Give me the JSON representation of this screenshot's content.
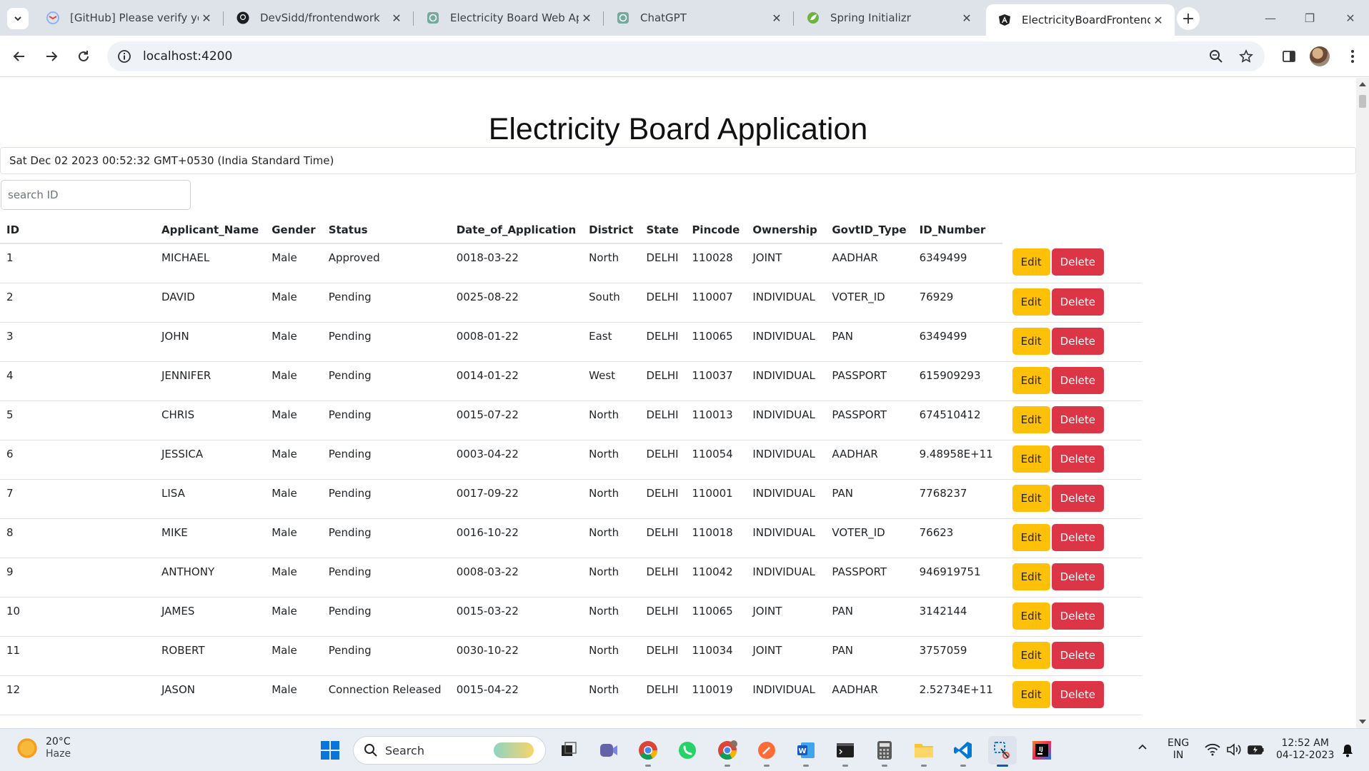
{
  "browser": {
    "tabs": [
      {
        "title": "[GitHub] Please verify your",
        "icon": "gmail-icon"
      },
      {
        "title": "DevSidd/frontendwork",
        "icon": "github-icon"
      },
      {
        "title": "Electricity Board Web App",
        "icon": "chatgpt-icon"
      },
      {
        "title": "ChatGPT",
        "icon": "chatgpt-icon"
      },
      {
        "title": "Spring Initializr",
        "icon": "spring-icon"
      },
      {
        "title": "ElectricityBoardFrontend",
        "icon": "angular-icon"
      }
    ],
    "url": "localhost:4200"
  },
  "page": {
    "title": "Electricity Board Application",
    "datetime": "Sat Dec 02 2023 00:52:32 GMT+0530 (India Standard Time)",
    "search_placeholder": "search ID",
    "edit_label": "Edit",
    "delete_label": "Delete"
  },
  "table": {
    "headers": [
      "ID",
      "Applicant_Name",
      "Gender",
      "Status",
      "Date_of_Application",
      "District",
      "State",
      "Pincode",
      "Ownership",
      "GovtID_Type",
      "ID_Number"
    ],
    "rows": [
      [
        "1",
        "MICHAEL",
        "Male",
        "Approved",
        "0018-03-22",
        "North",
        "DELHI",
        "110028",
        "JOINT",
        "AADHAR",
        "6349499"
      ],
      [
        "2",
        "DAVID",
        "Male",
        "Pending",
        "0025-08-22",
        "South",
        "DELHI",
        "110007",
        "INDIVIDUAL",
        "VOTER_ID",
        "76929"
      ],
      [
        "3",
        "JOHN",
        "Male",
        "Pending",
        "0008-01-22",
        "East",
        "DELHI",
        "110065",
        "INDIVIDUAL",
        "PAN",
        "6349499"
      ],
      [
        "4",
        "JENNIFER",
        "Male",
        "Pending",
        "0014-01-22",
        "West",
        "DELHI",
        "110037",
        "INDIVIDUAL",
        "PASSPORT",
        "615909293"
      ],
      [
        "5",
        "CHRIS",
        "Male",
        "Pending",
        "0015-07-22",
        "North",
        "DELHI",
        "110013",
        "INDIVIDUAL",
        "PASSPORT",
        "674510412"
      ],
      [
        "6",
        "JESSICA",
        "Male",
        "Pending",
        "0003-04-22",
        "North",
        "DELHI",
        "110054",
        "INDIVIDUAL",
        "AADHAR",
        "9.48958E+11"
      ],
      [
        "7",
        "LISA",
        "Male",
        "Pending",
        "0017-09-22",
        "North",
        "DELHI",
        "110001",
        "INDIVIDUAL",
        "PAN",
        "7768237"
      ],
      [
        "8",
        "MIKE",
        "Male",
        "Pending",
        "0016-10-22",
        "North",
        "DELHI",
        "110018",
        "INDIVIDUAL",
        "VOTER_ID",
        "76623"
      ],
      [
        "9",
        "ANTHONY",
        "Male",
        "Pending",
        "0008-03-22",
        "North",
        "DELHI",
        "110042",
        "INDIVIDUAL",
        "PASSPORT",
        "946919751"
      ],
      [
        "10",
        "JAMES",
        "Male",
        "Pending",
        "0015-03-22",
        "North",
        "DELHI",
        "110065",
        "JOINT",
        "PAN",
        "3142144"
      ],
      [
        "11",
        "ROBERT",
        "Male",
        "Pending",
        "0030-10-22",
        "North",
        "DELHI",
        "110034",
        "JOINT",
        "PAN",
        "3757059"
      ],
      [
        "12",
        "JASON",
        "Male",
        "Connection Released",
        "0015-04-22",
        "North",
        "DELHI",
        "110019",
        "INDIVIDUAL",
        "AADHAR",
        "2.52734E+11"
      ]
    ]
  },
  "taskbar": {
    "weather_temp": "20°C",
    "weather_desc": "Haze",
    "search_label": "Search",
    "lang_top": "ENG",
    "lang_bottom": "IN",
    "time": "12:52 AM",
    "date": "04-12-2023",
    "apps": [
      "teams-icon",
      "chrome-icon",
      "whatsapp-icon",
      "chrome-profile-icon",
      "postman-icon",
      "word-icon",
      "terminal-icon",
      "calculator-icon",
      "file-explorer-icon",
      "vscode-icon",
      "snipping-tool-icon",
      "intellij-icon"
    ]
  }
}
